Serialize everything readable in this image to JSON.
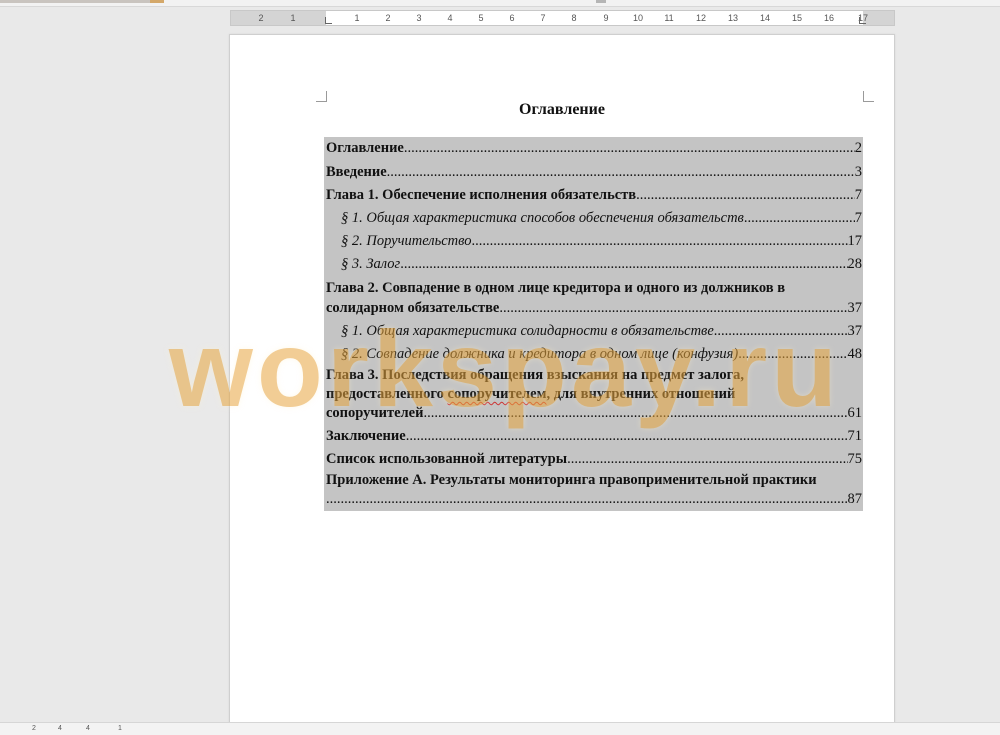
{
  "ruler": {
    "numbers": [
      "2",
      "1",
      "1",
      "2",
      "3",
      "4",
      "5",
      "6",
      "7",
      "8",
      "9",
      "10",
      "11",
      "12",
      "13",
      "14",
      "15",
      "16",
      "17"
    ]
  },
  "document": {
    "title": "Оглавление",
    "toc": [
      {
        "text": "Оглавление",
        "page": "2",
        "style": "bold"
      },
      {
        "text": "Введение",
        "page": "3",
        "style": "bold"
      },
      {
        "text": "Глава 1. Обеспечение исполнения обязательств",
        "page": "7",
        "style": "bold"
      },
      {
        "text": "§ 1. Общая характеристика способов обеспечения обязательств",
        "page": "7",
        "style": "italic"
      },
      {
        "text": "§ 2. Поручительство",
        "page": "17",
        "style": "italic"
      },
      {
        "text": "§ 3. Залог",
        "page": "28",
        "style": "italic"
      },
      {
        "line1": "Глава 2. Совпадение в одном лице кредитора и одного из должников в",
        "text": "солидарном обязательстве",
        "page": "37",
        "style": "bold"
      },
      {
        "text": "§ 1. Общая характеристика солидарности в обязательстве",
        "page": "37",
        "style": "italic"
      },
      {
        "text": "§ 2. Совпадение должника и кредитора в одном лице (конфузия)",
        "page": "48",
        "style": "italic"
      },
      {
        "line1": "Глава 3. Последствия обращения взыскания на предмет залога,",
        "line2a": "предоставленного ",
        "line2b": "сопоручителем",
        "line2c": ", для внутренних отношений",
        "text": "сопоручителей",
        "page": "61",
        "style": "bold"
      },
      {
        "text": "Заключение",
        "page": "71",
        "style": "bold"
      },
      {
        "text": "Список использованной литературы",
        "page": "75",
        "style": "bold"
      },
      {
        "line1": "Приложение А. Результаты мониторинга правоприменительной практики",
        "text": "",
        "page": "87",
        "style": "bold"
      }
    ]
  },
  "watermark": "workspay.ru",
  "statusbar": {
    "items": [
      "2",
      "4",
      "4",
      "1"
    ]
  },
  "colors": {
    "toc_highlight": "#c4c4c4",
    "watermark": "#e8a63f",
    "workspace": "#e9e9e9"
  }
}
